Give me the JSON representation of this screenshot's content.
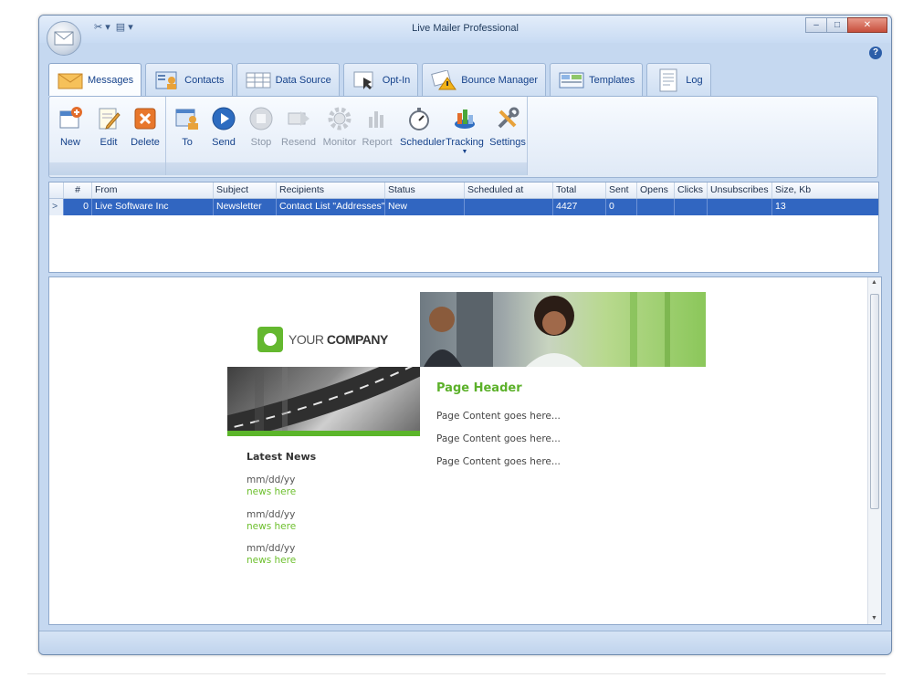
{
  "window": {
    "title": "Live Mailer Professional"
  },
  "quick_access": [
    "✂ ▾",
    "▤ ▾"
  ],
  "window_controls": {
    "minimize": "–",
    "maximize": "□",
    "close": "✕"
  },
  "help_label": "?",
  "tabs": [
    {
      "label": "Messages",
      "active": true,
      "icon": "envelope-icon"
    },
    {
      "label": "Contacts",
      "active": false,
      "icon": "contacts-icon"
    },
    {
      "label": "Data Source",
      "active": false,
      "icon": "table-icon"
    },
    {
      "label": "Opt-In",
      "active": false,
      "icon": "cursor-icon"
    },
    {
      "label": "Bounce Manager",
      "active": false,
      "icon": "warning-icon"
    },
    {
      "label": "Templates",
      "active": false,
      "icon": "template-icon"
    },
    {
      "label": "Log",
      "active": false,
      "icon": "log-icon"
    }
  ],
  "ribbon": {
    "buttons": [
      {
        "label": "New",
        "icon": "new-message-icon",
        "enabled": true
      },
      {
        "label": "Edit",
        "icon": "edit-icon",
        "enabled": true
      },
      {
        "label": "Delete",
        "icon": "delete-icon",
        "enabled": true
      },
      {
        "label": "To",
        "icon": "recipients-icon",
        "enabled": true
      },
      {
        "label": "Send",
        "icon": "play-icon",
        "enabled": true
      },
      {
        "label": "Stop",
        "icon": "stop-icon",
        "enabled": false
      },
      {
        "label": "Resend",
        "icon": "resend-icon",
        "enabled": false
      },
      {
        "label": "Monitor",
        "icon": "gear-icon",
        "enabled": false
      },
      {
        "label": "Report",
        "icon": "report-icon",
        "enabled": false
      },
      {
        "label": "Scheduler",
        "icon": "stopwatch-icon",
        "enabled": true
      },
      {
        "label": "Tracking",
        "icon": "tracking-icon",
        "enabled": true
      },
      {
        "label": "Settings",
        "icon": "tools-icon",
        "enabled": true
      }
    ]
  },
  "grid": {
    "columns": [
      "#",
      "From",
      "Subject",
      "Recipients",
      "Status",
      "Scheduled at",
      "Total",
      "Sent",
      "Opens",
      "Clicks",
      "Unsubscribes",
      "Size, Kb"
    ],
    "rows": [
      [
        "0",
        "Live Software Inc",
        "Newsletter",
        "Contact List \"Addresses\"",
        "New",
        "",
        "4427",
        "0",
        "",
        "",
        "",
        "13"
      ]
    ],
    "row_indicator": ">"
  },
  "preview": {
    "company": {
      "prefix": "YOUR",
      "name": "COMPANY"
    },
    "latest_news_title": "Latest News",
    "news": [
      {
        "date": "mm/dd/yy",
        "text": "news here"
      },
      {
        "date": "mm/dd/yy",
        "text": "news here"
      },
      {
        "date": "mm/dd/yy",
        "text": "news here"
      }
    ],
    "page_header": "Page Header",
    "content_lines": [
      "Page Content goes here...",
      "Page Content goes here...",
      "Page Content goes here..."
    ]
  },
  "colors": {
    "accent_green": "#5cb12a",
    "selection": "#3166c1",
    "frame": "#c5d8f0"
  }
}
